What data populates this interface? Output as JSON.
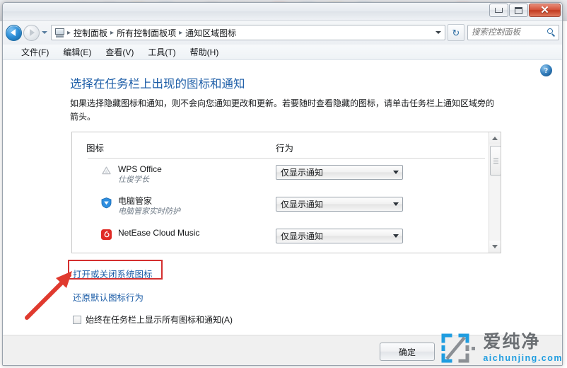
{
  "window": {
    "buttons": {
      "minimize": "最小化",
      "maximize": "最大化",
      "close": "✕"
    }
  },
  "navbar": {
    "back_label": "后退",
    "forward_label": "前进",
    "recent_label": "最近访问的位置",
    "computer_icon": "computer-icon",
    "breadcrumbs": [
      "控制面板",
      "所有控制面板项",
      "通知区域图标"
    ],
    "separator": "▸",
    "refresh_glyph": "↻",
    "search": {
      "placeholder": "搜索控制面板",
      "value": ""
    }
  },
  "menubar": {
    "items": [
      {
        "label": "文件(F)"
      },
      {
        "label": "编辑(E)"
      },
      {
        "label": "查看(V)"
      },
      {
        "label": "工具(T)"
      },
      {
        "label": "帮助(H)"
      }
    ]
  },
  "content": {
    "help_glyph": "?",
    "title": "选择在任务栏上出现的图标和通知",
    "description": "如果选择隐藏图标和通知，则不会向您通知更改和更新。若要随时查看隐藏的图标，请单击任务栏上通知区域旁的箭头。"
  },
  "list": {
    "columns": {
      "icon": "图标",
      "behavior": "行为"
    },
    "rows": [
      {
        "name": "WPS Office",
        "sub": "仕俊学长",
        "icon": "wps-office-icon",
        "behavior": "仅显示通知"
      },
      {
        "name": "电脑管家",
        "sub": "电脑管家实时防护",
        "icon": "pc-manager-shield-icon",
        "behavior": "仅显示通知"
      },
      {
        "name": "NetEase Cloud Music",
        "sub": "",
        "icon": "netease-cloud-music-icon",
        "behavior": "仅显示通知"
      }
    ],
    "scrollbar": {
      "up_label": "向上滚动",
      "down_label": "向下滚动"
    }
  },
  "links": {
    "system_icons": "打开或关闭系统图标",
    "restore_defaults": "还原默认图标行为"
  },
  "checkbox": {
    "always_show": "始终在任务栏上显示所有图标和通知(A)",
    "checked": false
  },
  "footer": {
    "ok": "确定"
  },
  "annotation": {
    "highlight_color": "#d42f2f",
    "arrow_color": "#e03a2f",
    "target": "打开或关闭系统图标"
  },
  "watermark": {
    "cn": "爱纯净",
    "domain": "aichunjing.com",
    "logo_color": "#1f9de0",
    "logo_accent": "#8c9095"
  },
  "colors": {
    "link": "#1f5fa8",
    "title": "#1f5fa8",
    "window_bg": "#f0f0f0",
    "close_button": "#c23a20"
  }
}
